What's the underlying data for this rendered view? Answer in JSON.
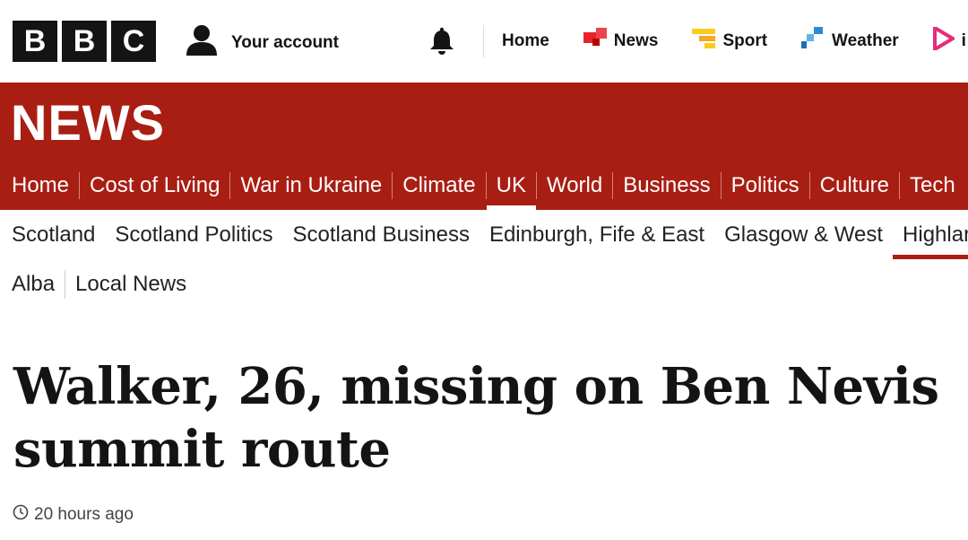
{
  "brand": {
    "logo_letters": [
      "B",
      "B",
      "C"
    ]
  },
  "account": {
    "label": "Your account",
    "icon": "person-icon"
  },
  "notifications": {
    "icon": "bell-icon"
  },
  "global_nav": [
    {
      "label": "Home",
      "icon": ""
    },
    {
      "label": "News",
      "icon": "news-icon",
      "color": "#e7232c"
    },
    {
      "label": "Sport",
      "icon": "sport-icon",
      "color": "#fbcb1c"
    },
    {
      "label": "Weather",
      "icon": "weather-icon",
      "color": "#2e8bd3"
    },
    {
      "label": "i",
      "icon": "iplayer-icon",
      "color": "#e62b7c"
    }
  ],
  "section_title": "NEWS",
  "primary_nav": [
    {
      "label": "Home",
      "active": false
    },
    {
      "label": "Cost of Living",
      "active": false
    },
    {
      "label": "War in Ukraine",
      "active": false
    },
    {
      "label": "Climate",
      "active": false
    },
    {
      "label": "UK",
      "active": true
    },
    {
      "label": "World",
      "active": false
    },
    {
      "label": "Business",
      "active": false
    },
    {
      "label": "Politics",
      "active": false
    },
    {
      "label": "Culture",
      "active": false
    },
    {
      "label": "Tech",
      "active": false
    }
  ],
  "secondary_nav": [
    {
      "label": "Scotland",
      "active": false
    },
    {
      "label": "Scotland Politics",
      "active": false
    },
    {
      "label": "Scotland Business",
      "active": false
    },
    {
      "label": "Edinburgh, Fife & East",
      "active": false
    },
    {
      "label": "Glasgow & West",
      "active": false
    },
    {
      "label": "Highlan",
      "active": true
    }
  ],
  "tertiary_nav": [
    {
      "label": "Alba"
    },
    {
      "label": "Local News"
    }
  ],
  "article": {
    "headline": "Walker, 26, missing on Ben Nevis summit route",
    "timestamp": "20 hours ago"
  },
  "colors": {
    "brand_red": "#a91e13",
    "text": "#141414"
  }
}
